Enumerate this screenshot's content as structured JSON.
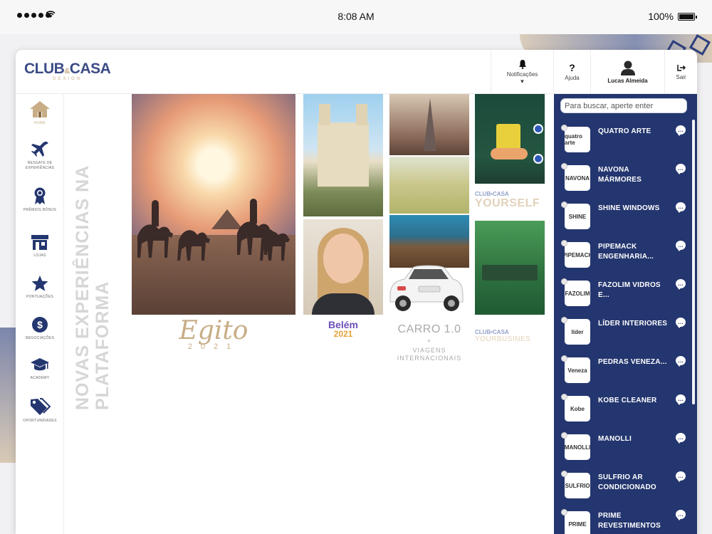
{
  "status_bar": {
    "time": "8:08 AM",
    "battery": "100%"
  },
  "app": {
    "logo_main": "CLUB",
    "logo_amp": "&",
    "logo_main2": "CASA",
    "logo_sub": "DESIGN"
  },
  "topbar": {
    "notifications_label": "Notificações",
    "help_label": "Ajuda",
    "user_name": "Lucas Almeida",
    "exit_label": "Sair"
  },
  "sidebar": {
    "items": [
      {
        "label": "HOME",
        "icon": "home-icon"
      },
      {
        "label": "RESGATE DE EXPERIÊNCIAS",
        "icon": "airplane-icon"
      },
      {
        "label": "PRÊMIOS BÔNUS",
        "icon": "medal-icon"
      },
      {
        "label": "LOJAS",
        "icon": "store-icon"
      },
      {
        "label": "PONTUAÇÕES",
        "icon": "star-icon"
      },
      {
        "label": "NEGOCIAÇÕES",
        "icon": "money-icon"
      },
      {
        "label": "ACADEMY",
        "icon": "graduation-cap-icon"
      },
      {
        "label": "OPORTUNIDADES",
        "icon": "tags-icon"
      }
    ]
  },
  "main": {
    "vertical_title": "NOVAS EXPERIÊNCIAS NA PLATAFORMA",
    "egito_title": "Egito",
    "egito_year": "2021",
    "belem_title": "Belém",
    "belem_year": "2021",
    "carro_title": "CARRO 1.0",
    "carro_plus": "+",
    "carro_sub": "VIAGENS INTERNACIONAIS",
    "club_mini_logo": "CLUB•CASA",
    "club_mini_text": "YOURSELF",
    "office_logo": "CLUB•CASA",
    "office_text": "YOURBUSINES"
  },
  "panel": {
    "search_placeholder": "Para buscar, aperte enter",
    "partners": [
      {
        "name": "QUATRO ARTE",
        "logo": "quatro arte"
      },
      {
        "name": "NAVONA MÁRMORES",
        "logo": "NAVONA"
      },
      {
        "name": "SHINE WINDOWS",
        "logo": "SHINE"
      },
      {
        "name": "PIPEMACK ENGENHARIA...",
        "logo": "PIPEMACK"
      },
      {
        "name": "FAZOLIM VIDROS E...",
        "logo": "FAZOLIM"
      },
      {
        "name": "LÍDER INTERIORES",
        "logo": "líder"
      },
      {
        "name": "PEDRAS VENEZA...",
        "logo": "Veneza"
      },
      {
        "name": "KOBE CLEANER",
        "logo": "Kobe"
      },
      {
        "name": "MANOLLI",
        "logo": "MANOLLI"
      },
      {
        "name": "SULFRIO AR CONDICIONADO",
        "logo": "SULFRIO"
      },
      {
        "name": "PRIME REVESTIMENTOS",
        "logo": "PRIME"
      }
    ]
  },
  "colors": {
    "brand_navy": "#24366f",
    "brand_gold": "#c8ad86"
  }
}
